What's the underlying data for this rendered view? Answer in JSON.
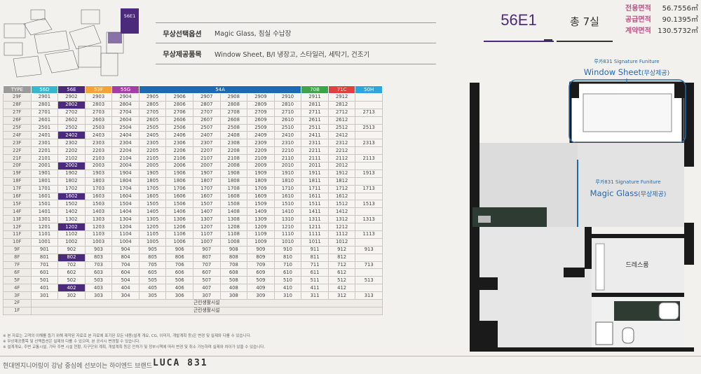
{
  "keyplan": {
    "unit_label": "56E1"
  },
  "options": [
    {
      "label": "무상선택옵션",
      "value": "Magic Glass, 침실 수납장"
    },
    {
      "label": "무상제공품목",
      "value": "Window Sheet, B/I 냉장고, 스타일러, 세탁기, 건조기"
    }
  ],
  "unit": {
    "name": "56E1",
    "floors": "총 7실"
  },
  "areas": [
    {
      "label": "전용면적",
      "value": "56.7556㎡"
    },
    {
      "label": "공급면적",
      "value": "90.1395㎡"
    },
    {
      "label": "계약면적",
      "value": "130.5732㎡"
    }
  ],
  "table": {
    "headers": [
      {
        "label": "TYPE",
        "color": "#9a9a9a"
      },
      {
        "label": "56D",
        "color": "#35b8c9"
      },
      {
        "label": "56E",
        "color": "#4b2a7b"
      },
      {
        "label": "53F",
        "color": "#f2a33a"
      },
      {
        "label": "55G",
        "color": "#a040a0"
      },
      {
        "label": "54A",
        "color": "#1f68b3"
      },
      {
        "label": "70B",
        "color": "#3fa34d"
      },
      {
        "label": "71C",
        "color": "#e04040"
      },
      {
        "label": "50H",
        "color": "#2aa7e0"
      }
    ],
    "rows": [
      [
        "29F",
        "2901",
        "2902",
        "2903",
        "2904",
        "2905",
        "2906",
        "2907",
        "2908",
        "2909",
        "2910",
        "2911",
        "2912",
        ""
      ],
      [
        "28F",
        "2801",
        "2802",
        "2803",
        "2804",
        "2805",
        "2806",
        "2807",
        "2808",
        "2809",
        "2810",
        "2811",
        "2812",
        ""
      ],
      [
        "27F",
        "2701",
        "2702",
        "2703",
        "2704",
        "2705",
        "2706",
        "2707",
        "2708",
        "2709",
        "2710",
        "2711",
        "2712",
        "2713"
      ],
      [
        "26F",
        "2601",
        "2602",
        "2603",
        "2604",
        "2605",
        "2606",
        "2607",
        "2608",
        "2609",
        "2610",
        "2611",
        "2612",
        ""
      ],
      [
        "25F",
        "2501",
        "2502",
        "2503",
        "2504",
        "2505",
        "2506",
        "2507",
        "2508",
        "2509",
        "2510",
        "2511",
        "2512",
        "2513"
      ],
      [
        "24F",
        "2401",
        "2402",
        "2403",
        "2404",
        "2405",
        "2406",
        "2407",
        "2408",
        "2409",
        "2410",
        "2411",
        "2412",
        ""
      ],
      [
        "23F",
        "2301",
        "2302",
        "2303",
        "2304",
        "2305",
        "2306",
        "2307",
        "2308",
        "2309",
        "2310",
        "2311",
        "2312",
        "2313"
      ],
      [
        "22F",
        "2201",
        "2202",
        "2203",
        "2204",
        "2205",
        "2206",
        "2207",
        "2208",
        "2209",
        "2210",
        "2211",
        "2212",
        ""
      ],
      [
        "21F",
        "2101",
        "2102",
        "2103",
        "2104",
        "2105",
        "2106",
        "2107",
        "2108",
        "2109",
        "2110",
        "2111",
        "2112",
        "2113"
      ],
      [
        "20F",
        "2001",
        "2002",
        "2003",
        "2004",
        "2005",
        "2006",
        "2007",
        "2008",
        "2009",
        "2010",
        "2011",
        "2012",
        ""
      ],
      [
        "19F",
        "1901",
        "1902",
        "1903",
        "1904",
        "1905",
        "1906",
        "1907",
        "1908",
        "1909",
        "1910",
        "1911",
        "1912",
        "1913"
      ],
      [
        "18F",
        "1801",
        "1802",
        "1803",
        "1804",
        "1805",
        "1806",
        "1807",
        "1808",
        "1809",
        "1810",
        "1811",
        "1812",
        ""
      ],
      [
        "17F",
        "1701",
        "1702",
        "1703",
        "1704",
        "1705",
        "1706",
        "1707",
        "1708",
        "1709",
        "1710",
        "1711",
        "1712",
        "1713"
      ],
      [
        "16F",
        "1601",
        "1602",
        "1603",
        "1604",
        "1605",
        "1606",
        "1607",
        "1608",
        "1609",
        "1610",
        "1611",
        "1612",
        ""
      ],
      [
        "15F",
        "1501",
        "1502",
        "1503",
        "1504",
        "1505",
        "1506",
        "1507",
        "1508",
        "1509",
        "1510",
        "1511",
        "1512",
        "1513"
      ],
      [
        "14F",
        "1401",
        "1402",
        "1403",
        "1404",
        "1405",
        "1406",
        "1407",
        "1408",
        "1409",
        "1410",
        "1411",
        "1412",
        ""
      ],
      [
        "13F",
        "1301",
        "1302",
        "1303",
        "1304",
        "1305",
        "1306",
        "1307",
        "1308",
        "1309",
        "1310",
        "1311",
        "1312",
        "1313"
      ],
      [
        "12F",
        "1201",
        "1202",
        "1203",
        "1204",
        "1205",
        "1206",
        "1207",
        "1208",
        "1209",
        "1210",
        "1211",
        "1212",
        ""
      ],
      [
        "11F",
        "1101",
        "1102",
        "1103",
        "1104",
        "1105",
        "1106",
        "1107",
        "1108",
        "1109",
        "1110",
        "1111",
        "1112",
        "1113"
      ],
      [
        "10F",
        "1001",
        "1002",
        "1003",
        "1004",
        "1005",
        "1006",
        "1007",
        "1008",
        "1009",
        "1010",
        "1011",
        "1012",
        ""
      ],
      [
        "9F",
        "901",
        "902",
        "903",
        "904",
        "905",
        "906",
        "907",
        "908",
        "909",
        "910",
        "911",
        "912",
        "913"
      ],
      [
        "8F",
        "801",
        "802",
        "803",
        "804",
        "805",
        "806",
        "807",
        "808",
        "809",
        "810",
        "811",
        "812",
        ""
      ],
      [
        "7F",
        "701",
        "702",
        "703",
        "704",
        "705",
        "706",
        "707",
        "708",
        "709",
        "710",
        "711",
        "712",
        "713"
      ],
      [
        "6F",
        "601",
        "602",
        "603",
        "604",
        "605",
        "606",
        "607",
        "608",
        "609",
        "610",
        "611",
        "612",
        ""
      ],
      [
        "5F",
        "501",
        "502",
        "503",
        "504",
        "505",
        "506",
        "507",
        "508",
        "509",
        "510",
        "511",
        "512",
        "513"
      ],
      [
        "4F",
        "401",
        "402",
        "403",
        "404",
        "405",
        "406",
        "407",
        "408",
        "409",
        "410",
        "411",
        "412",
        ""
      ],
      [
        "3F",
        "301",
        "302",
        "303",
        "304",
        "305",
        "306",
        "307",
        "308",
        "309",
        "310",
        "311",
        "312",
        "313"
      ]
    ],
    "highlight_rows": [
      "28F",
      "24F",
      "20F",
      "16F",
      "12F",
      "8F",
      "4F"
    ],
    "span_rows": [
      {
        "floor": "2F",
        "text": "근린생활시설"
      },
      {
        "floor": "1F",
        "text": "근린생활시설"
      }
    ]
  },
  "notes": [
    "※ 본 자료는 고객의 이해를 돕기 위해 제작된 자료로 본 자료에 표기된 모든 내용(설계 개요, CG, 이미지, 개발계획 등)은 변경 및 실제와 다를 수 있습니다.",
    "※ 무상제공품목 및 선택옵션은 실제와 다를 수 있으며, 본 공사시 변경될 수 있습니다.",
    "※ 설계개요, 주변 교통시설, 기타 주변 시설 현황, 지구단위 계획, 개발계획 등은 인허가 및 정부시책에 따라 변경 및 취소 가능하며 실제와 차이가 있을 수 있습니다."
  ],
  "footer": {
    "text": "현대엔지니어링이 강남 중심에 선보이는 하이엔드 브랜드",
    "brand": "LUCA 831"
  },
  "plan": {
    "callout1_sub": "루카831 Signature Funiture",
    "callout1_title": "Window Sheet",
    "callout1_kr": "(무상제공)",
    "callout2_sub": "루카831 Signature Funiture",
    "callout2_title": "Magic Glass",
    "callout2_kr": "(무상제공)",
    "room_dress": "드레스룸"
  },
  "colors": {
    "accent": "#4b2a7b",
    "blue": "#1f68b3",
    "pink": "#c64b8a"
  }
}
